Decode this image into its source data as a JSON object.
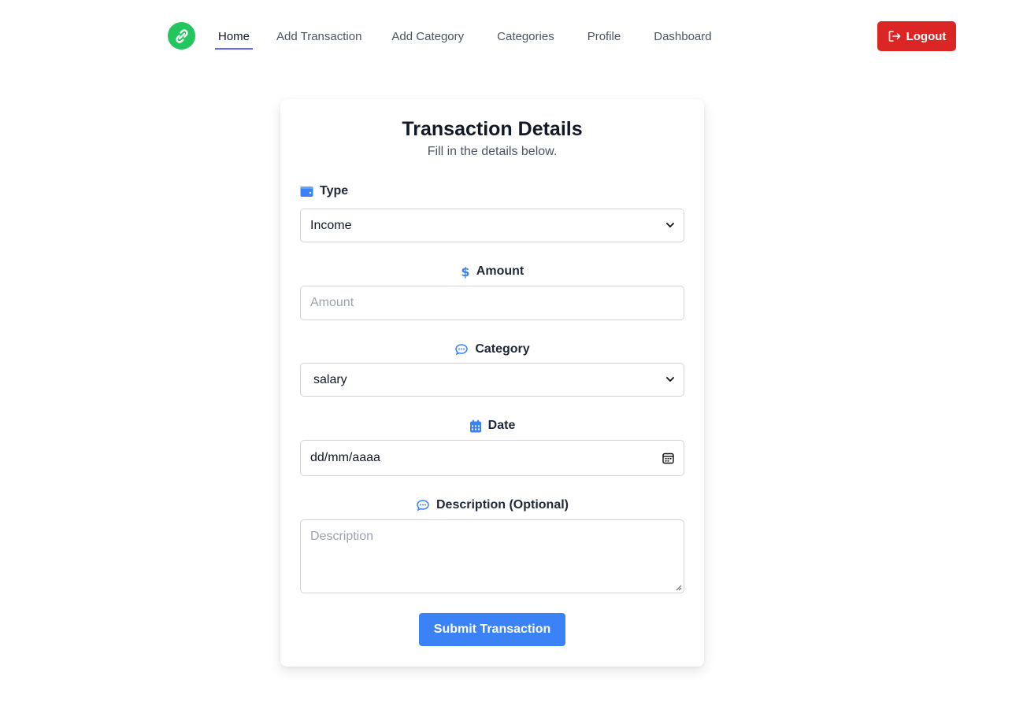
{
  "nav": {
    "logo_icon": "link-circle-icon",
    "links": [
      "Home",
      "Add Transaction",
      "Add Category",
      "Categories",
      "Profile",
      "Dashboard"
    ],
    "active": "Home",
    "logout_label": "Logout",
    "logout_icon": "logout-icon"
  },
  "form": {
    "title": "Transaction Details",
    "subtitle": "Fill in the details below.",
    "type": {
      "label": "Type",
      "value": "Income",
      "icon": "wallet-icon"
    },
    "amount": {
      "label": "Amount",
      "placeholder": "Amount",
      "icon": "dollar-icon"
    },
    "category": {
      "label": "Category",
      "value": "salary",
      "icon": "chat-bubble-icon"
    },
    "date": {
      "label": "Date",
      "value": "dd/mm/aaaa",
      "icon": "calendar-icon"
    },
    "description": {
      "label": "Description (Optional)",
      "placeholder": "Description",
      "icon": "chat-bubble-icon"
    },
    "submit_label": "Submit Transaction"
  },
  "colors": {
    "accent": "#3b82f6",
    "logout": "#dc2626",
    "logo": "#22c55e",
    "active_underline": "#6366f1"
  }
}
